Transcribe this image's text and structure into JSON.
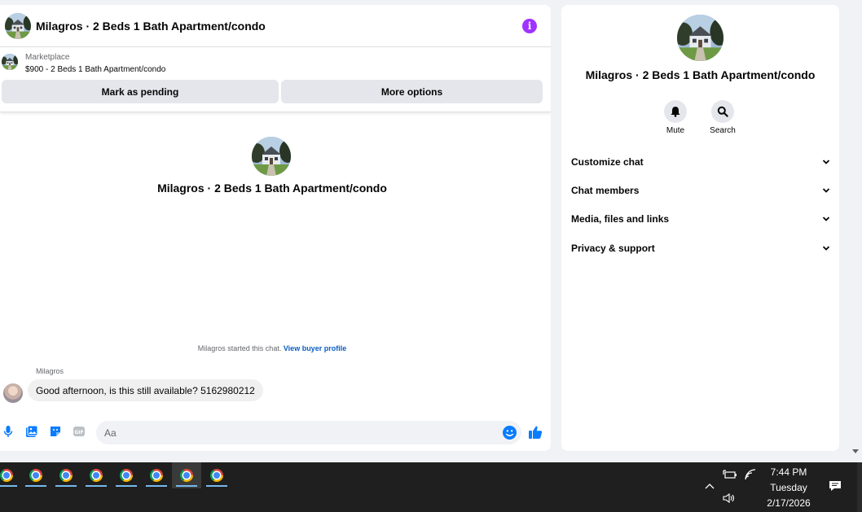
{
  "chat": {
    "header_title": "Milagros · 2 Beds 1 Bath Apartment/condo",
    "marketplace_label": "Marketplace",
    "listing_text": "$900 - 2 Beds 1 Bath Apartment/condo",
    "mark_pending_label": "Mark as pending",
    "more_options_label": "More options",
    "center_title": "Milagros · 2 Beds 1 Bath Apartment/condo",
    "started_text": "Milagros started this chat.",
    "view_profile_link": "View buyer profile",
    "sender_name": "Milagros",
    "message_text": "Good afternoon, is this still available? 5162980212",
    "composer_placeholder": "Aa",
    "composer_icons": [
      "microphone-icon",
      "photo-icon",
      "sticker-icon",
      "gif-icon",
      "emoji-icon",
      "thumbs-up-icon"
    ]
  },
  "info_panel": {
    "title": "Milagros · 2 Beds 1 Bath Apartment/condo",
    "actions": [
      {
        "label": "Mute",
        "icon": "bell-icon"
      },
      {
        "label": "Search",
        "icon": "search-icon"
      }
    ],
    "sections": [
      {
        "label": "Customize chat"
      },
      {
        "label": "Chat members"
      },
      {
        "label": "Media, files and links"
      },
      {
        "label": "Privacy & support"
      }
    ]
  },
  "taskbar": {
    "app_icons": [
      "chrome-icon",
      "chrome-icon",
      "chrome-icon",
      "chrome-icon",
      "chrome-icon",
      "chrome-icon",
      "chrome-icon",
      "chrome-icon"
    ],
    "time": "7:44 PM",
    "day": "Tuesday",
    "date": "2/17/2026"
  },
  "colors": {
    "accent_blue": "#0a7cff",
    "info_purple": "#a033ff",
    "link_blue": "#0a5dc2",
    "page_bg": "#f0f2f5",
    "taskbar_bg": "#1f1f1f"
  }
}
